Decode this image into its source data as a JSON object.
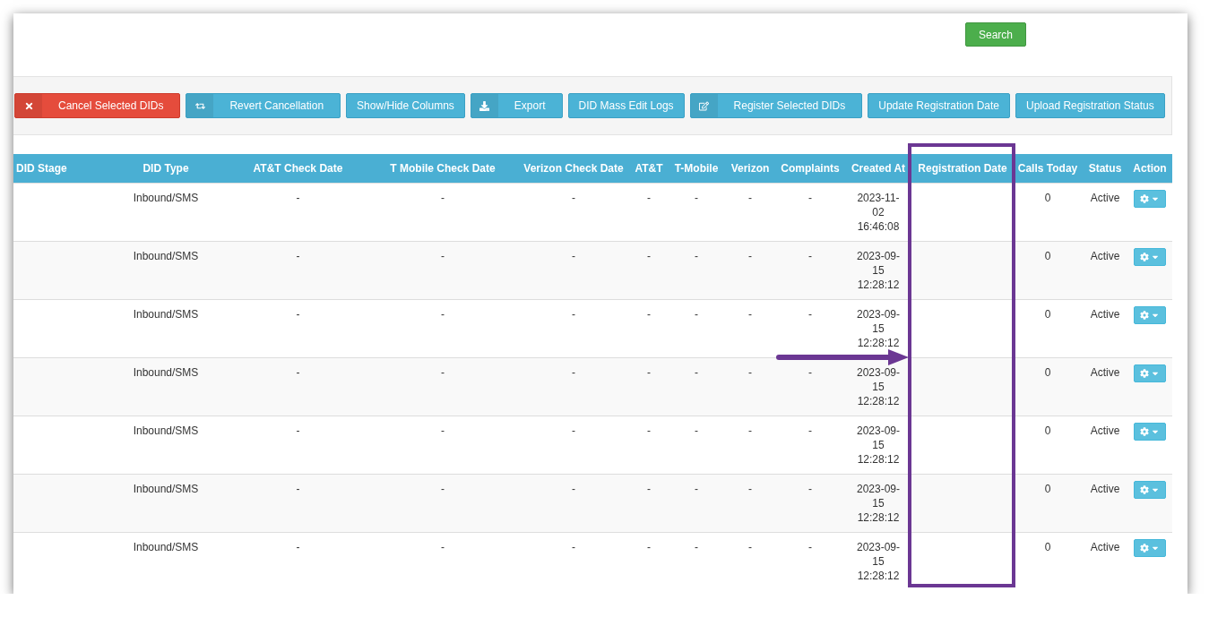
{
  "search_button": {
    "label": "Search"
  },
  "toolbar_buttons": [
    {
      "label": "Cancel Selected DIDs",
      "kind": "cancel"
    },
    {
      "label": "Revert Cancellation",
      "kind": "revert"
    },
    {
      "label": "Show/Hide Columns",
      "kind": "plain"
    },
    {
      "label": "Export",
      "kind": "export"
    },
    {
      "label": "DID Mass Edit Logs",
      "kind": "plain"
    },
    {
      "label": "Register Selected DIDs",
      "kind": "register"
    },
    {
      "label": "Update Registration Date",
      "kind": "plain"
    },
    {
      "label": "Upload Registration Status",
      "kind": "plain"
    }
  ],
  "table": {
    "columns": [
      "DID Stage",
      "DID Type",
      "AT&T Check Date",
      "T Mobile Check Date",
      "Verizon Check Date",
      "AT&T",
      "T-Mobile",
      "Verizon",
      "Complaints",
      "Created At",
      "Registration Date",
      "Calls Today",
      "Status",
      "Action"
    ],
    "rows": [
      {
        "did_type": "Inbound/SMS",
        "att_check_date": "-",
        "tmobile_check_date": "-",
        "verizon_check_date": "-",
        "att": "-",
        "tmobile": "-",
        "verizon": "-",
        "complaints": "-",
        "created_at": "2023-11-02 16:46:08",
        "calls_today": "0",
        "status": "Active"
      },
      {
        "did_type": "Inbound/SMS",
        "att_check_date": "-",
        "tmobile_check_date": "-",
        "verizon_check_date": "-",
        "att": "-",
        "tmobile": "-",
        "verizon": "-",
        "complaints": "-",
        "created_at": "2023-09-15 12:28:12",
        "calls_today": "0",
        "status": "Active"
      },
      {
        "did_type": "Inbound/SMS",
        "att_check_date": "-",
        "tmobile_check_date": "-",
        "verizon_check_date": "-",
        "att": "-",
        "tmobile": "-",
        "verizon": "-",
        "complaints": "-",
        "created_at": "2023-09-15 12:28:12",
        "calls_today": "0",
        "status": "Active"
      },
      {
        "did_type": "Inbound/SMS",
        "att_check_date": "-",
        "tmobile_check_date": "-",
        "verizon_check_date": "-",
        "att": "-",
        "tmobile": "-",
        "verizon": "-",
        "complaints": "-",
        "created_at": "2023-09-15 12:28:12",
        "calls_today": "0",
        "status": "Active"
      },
      {
        "did_type": "Inbound/SMS",
        "att_check_date": "-",
        "tmobile_check_date": "-",
        "verizon_check_date": "-",
        "att": "-",
        "tmobile": "-",
        "verizon": "-",
        "complaints": "-",
        "created_at": "2023-09-15 12:28:12",
        "calls_today": "0",
        "status": "Active"
      },
      {
        "did_type": "Inbound/SMS",
        "att_check_date": "-",
        "tmobile_check_date": "-",
        "verizon_check_date": "-",
        "att": "-",
        "tmobile": "-",
        "verizon": "-",
        "complaints": "-",
        "created_at": "2023-09-15 12:28:12",
        "calls_today": "0",
        "status": "Active"
      },
      {
        "did_type": "Inbound/SMS",
        "att_check_date": "-",
        "tmobile_check_date": "-",
        "verizon_check_date": "-",
        "att": "-",
        "tmobile": "-",
        "verizon": "-",
        "complaints": "-",
        "created_at": "2023-09-15 12:28:12",
        "calls_today": "0",
        "status": "Active"
      }
    ]
  }
}
